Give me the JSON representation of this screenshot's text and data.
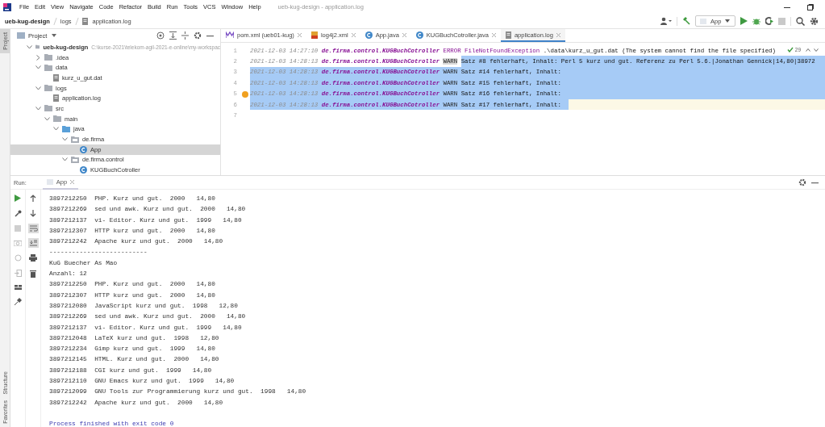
{
  "window": {
    "title": "ueb-kug-design - application.log"
  },
  "menu": [
    "File",
    "Edit",
    "View",
    "Navigate",
    "Code",
    "Refactor",
    "Build",
    "Run",
    "Tools",
    "VCS",
    "Window",
    "Help"
  ],
  "breadcrumb": [
    "ueb-kug-design",
    "logs",
    "application.log"
  ],
  "toolbar": {
    "run_config": "App"
  },
  "tool_strip": {
    "top": [
      {
        "label": "Project",
        "selected": true
      }
    ],
    "bottom": [
      {
        "label": "Structure"
      },
      {
        "label": "Favorites"
      }
    ]
  },
  "project_panel": {
    "title": "Project",
    "tree": [
      {
        "label": "ueb-kug-design",
        "path": "C:\\kurse-2021\\telekom-agil-2021-e-online\\my-workspac",
        "kind": "module",
        "expanded": true,
        "selected": false,
        "children": [
          {
            "label": ".idea",
            "kind": "folder",
            "expanded": false,
            "selected": false
          },
          {
            "label": "data",
            "kind": "folder",
            "expanded": true,
            "selected": false,
            "children": [
              {
                "label": "kurz_u_gut.dat",
                "kind": "file",
                "selected": false
              }
            ]
          },
          {
            "label": "logs",
            "kind": "folder",
            "expanded": true,
            "selected": false,
            "children": [
              {
                "label": "application.log",
                "kind": "file",
                "selected": false
              }
            ]
          },
          {
            "label": "src",
            "kind": "folder",
            "expanded": true,
            "selected": false,
            "children": [
              {
                "label": "main",
                "kind": "folder",
                "expanded": true,
                "selected": false,
                "children": [
                  {
                    "label": "java",
                    "kind": "source",
                    "expanded": true,
                    "selected": false,
                    "children": [
                      {
                        "label": "de.firma",
                        "kind": "package",
                        "expanded": true,
                        "selected": false,
                        "children": [
                          {
                            "label": "App",
                            "kind": "class",
                            "selected": true
                          }
                        ]
                      },
                      {
                        "label": "de.firma.control",
                        "kind": "package",
                        "expanded": true,
                        "selected": false,
                        "children": [
                          {
                            "label": "KUGBuchCotroller",
                            "kind": "class",
                            "selected": false
                          }
                        ]
                      }
                    ]
                  }
                ]
              }
            ]
          }
        ]
      }
    ]
  },
  "editor_tabs": [
    {
      "label": "pom.xml (ueb01-kug)",
      "kind": "maven",
      "selected": false
    },
    {
      "label": "log4j2.xml",
      "kind": "xml",
      "selected": false
    },
    {
      "label": "App.java",
      "kind": "class",
      "selected": false
    },
    {
      "label": "KUGBuchCotroller.java",
      "kind": "class",
      "selected": false
    },
    {
      "label": "application.log",
      "kind": "file",
      "selected": true
    }
  ],
  "editor": {
    "warnings": "29",
    "lines": [
      {
        "number": "1",
        "date": "2021-12-03 14:27:10",
        "logger": "de.firma.control.KUGBuchCotroller",
        "level": "ERROR",
        "level_highlighted": false,
        "exception": "FileNotFoundException",
        "message": ".\\data\\kurz_u_gut.dat (The system cannot find the file specified)",
        "kind": "plain"
      },
      {
        "number": "2",
        "date": "2021-12-03 14:28:13",
        "logger": "de.firma.control.KUGBuchCotroller",
        "level": "WARN",
        "level_highlighted": true,
        "message": "Satz #8 fehlerhaft, Inhalt: Perl 5 kurz und gut. Referenz zu Perl 5.6.|Jonathan Gennick|14,80|38972",
        "kind": "selection_tail"
      },
      {
        "number": "3",
        "date": "2021-12-03 14:28:13",
        "logger": "de.firma.control.KUGBuchCotroller",
        "level": "WARN",
        "level_highlighted": false,
        "message": "Satz #14 fehlerhaft, Inhalt:",
        "kind": "selected"
      },
      {
        "number": "4",
        "date": "2021-12-03 14:28:13",
        "logger": "de.firma.control.KUGBuchCotroller",
        "level": "WARN",
        "level_highlighted": false,
        "message": "Satz #15 fehlerhaft, Inhalt:",
        "kind": "selected"
      },
      {
        "number": "5",
        "date": "2021-12-03 14:28:13",
        "logger": "de.firma.control.KUGBuchCotroller",
        "level": "WARN",
        "level_highlighted": false,
        "message": "Satz #16 fehlerhaft, Inhalt:",
        "kind": "selected",
        "bulb": true
      },
      {
        "number": "6",
        "date": "2021-12-03 14:28:13",
        "logger": "de.firma.control.KUGBuchCotroller",
        "level": "WARN",
        "level_highlighted": false,
        "message": "Satz #17 fehlerhaft, Inhalt:",
        "kind": "selection_head"
      },
      {
        "number": "7",
        "kind": "plain"
      }
    ]
  },
  "run_panel": {
    "label": "Run:",
    "tabs": [
      {
        "label": "App",
        "selected": true
      }
    ],
    "console": [
      "3897212250  PHP. Kurz und gut.  2000   14,80",
      "3897212269  sed und awk. Kurz und gut.  2000   14,80",
      "3897212137  vi- Editor. Kurz und gut.  1999   14,80",
      "3897212307  HTTP kurz und gut.  2000   14,80",
      "3897212242  Apache kurz und gut.  2000   14,80",
      "--------------------------",
      "KuG Buecher As Mao",
      "Anzahl: 12",
      "3897212250  PHP. Kurz und gut.  2000   14,80",
      "3897212307  HTTP kurz und gut.  2000   14,80",
      "3897212080  JavaScript kurz und gut.  1998   12,80",
      "3897212269  sed und awk. Kurz und gut.  2000   14,80",
      "3897212137  vi- Editor. Kurz und gut.  1999   14,80",
      "3897212048  LaTeX kurz und gut.  1998   12,80",
      "3897212234  Gimp kurz und gut.  1999   14,80",
      "3897212145  HTML. Kurz und gut.  2000   14,80",
      "3897212188  CGI kurz und gut.  1999   14,80",
      "3897212110  GNU Emacs kurz und gut.  1999   14,80",
      "3897212099  GNU Tools zur Programmierung kurz und gut.  1998   14,80",
      "3897212242  Apache kurz und gut.  2000   14,80"
    ],
    "exit_message": "Process finished with exit code 0"
  }
}
